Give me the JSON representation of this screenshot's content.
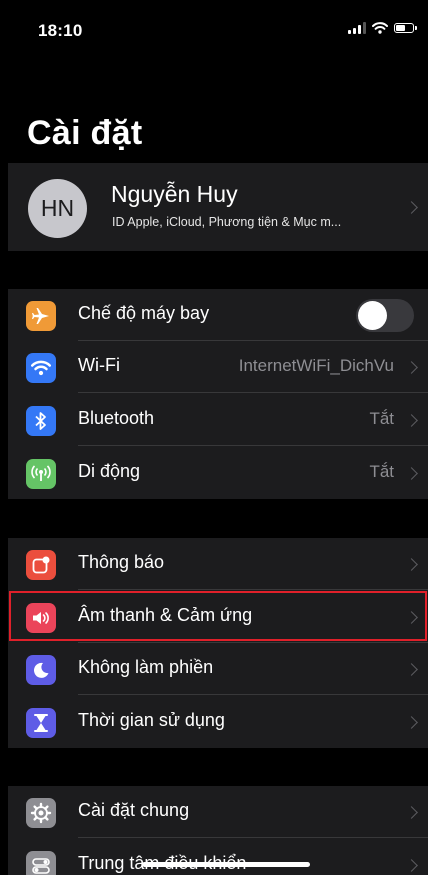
{
  "status_bar": {
    "time": "18:10",
    "icons": [
      "signal-icon",
      "wifi-icon",
      "battery-icon"
    ]
  },
  "page": {
    "title": "Cài đặt"
  },
  "profile": {
    "initials": "HN",
    "name": "Nguyễn Huy",
    "subtitle": "ID Apple, iCloud, Phương tiện & Mục m..."
  },
  "group1": {
    "airplane": {
      "label": "Chế độ máy bay",
      "icon": "airplane-icon",
      "color": "#f09a37",
      "toggle_on": false
    },
    "wifi": {
      "label": "Wi-Fi",
      "value": "InternetWiFi_DichVu",
      "icon": "wifi-icon",
      "color": "#3478f6"
    },
    "bluetooth": {
      "label": "Bluetooth",
      "value": "Tắt",
      "icon": "bluetooth-icon",
      "color": "#3478f6"
    },
    "cellular": {
      "label": "Di động",
      "value": "Tắt",
      "icon": "cellular-antenna-icon",
      "color": "#65c466"
    }
  },
  "group2": {
    "notifications": {
      "label": "Thông báo",
      "icon": "notification-badge-icon",
      "color": "#eb4e3d"
    },
    "sounds": {
      "label": "Âm thanh & Cảm ứng",
      "icon": "speaker-icon",
      "color": "#eb445a",
      "highlighted": true
    },
    "dnd": {
      "label": "Không làm phiền",
      "icon": "moon-icon",
      "color": "#5e5ce6"
    },
    "screen_time": {
      "label": "Thời gian sử dụng",
      "icon": "hourglass-icon",
      "color": "#5e5ce6"
    }
  },
  "group3": {
    "general": {
      "label": "Cài đặt chung",
      "icon": "gear-icon",
      "color": "#8e8e93"
    },
    "control_center": {
      "label": "Trung tâm điều khiển",
      "icon": "toggles-icon",
      "color": "#8e8e93"
    }
  }
}
